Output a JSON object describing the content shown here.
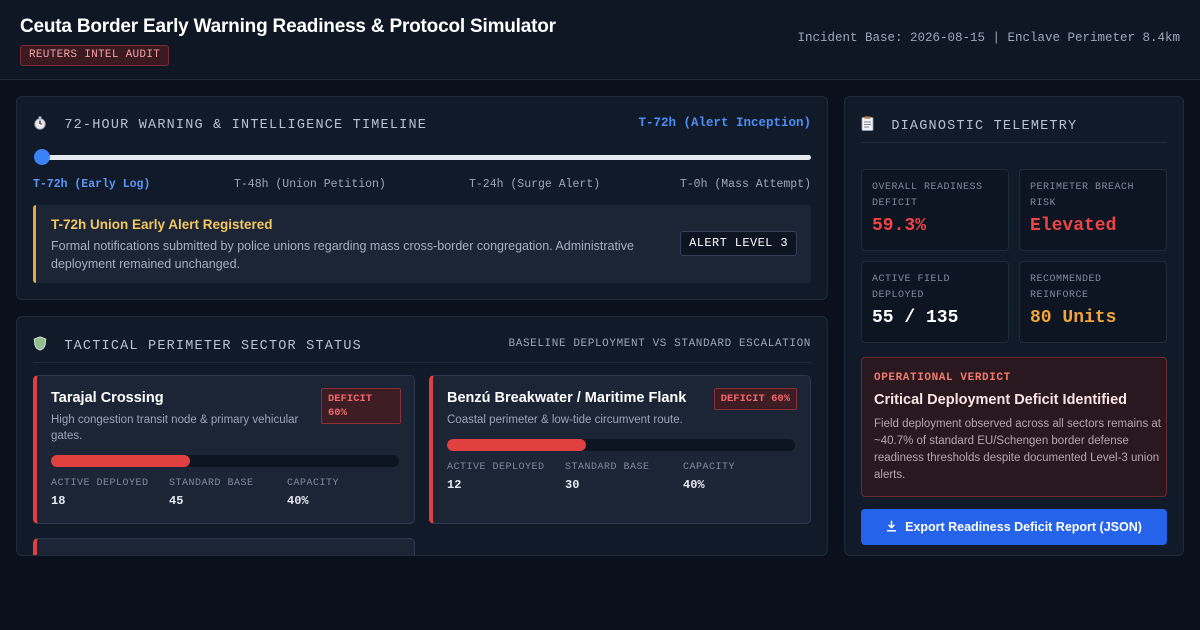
{
  "header": {
    "title": "Ceuta Border Early Warning Readiness & Protocol Simulator",
    "badge": "REUTERS INTEL AUDIT",
    "meta": "Incident Base: 2026-08-15 | Enclave Perimeter 8.4km"
  },
  "timeline": {
    "icon": "stopwatch-icon",
    "title": "72-HOUR WARNING & INTELLIGENCE TIMELINE",
    "current_label": "T-72h (Alert Inception)",
    "slider_position": 0,
    "labels": [
      "T-72h (Early Log)",
      "T-48h (Union Petition)",
      "T-24h (Surge Alert)",
      "T-0h (Mass Attempt)"
    ],
    "alert": {
      "title": "T-72h Union Early Alert Registered",
      "description": "Formal notifications submitted by police unions regarding mass cross-border congregation. Administrative deployment remained unchanged.",
      "level": "ALERT LEVEL 3",
      "accent_color": "#e7a93a"
    }
  },
  "sectors": {
    "icon": "shield-icon",
    "title": "TACTICAL PERIMETER SECTOR STATUS",
    "subtitle": "BASELINE DEPLOYMENT VS STANDARD ESCALATION",
    "stat_labels": {
      "deployed": "ACTIVE DEPLOYED",
      "standard": "STANDARD BASE",
      "capacity": "CAPACITY"
    },
    "cards": [
      {
        "name": "Tarajal Crossing",
        "description": "High congestion transit node & primary vehicular gates.",
        "deficit_line1": "DEFICIT",
        "deficit_line2": "60%",
        "deployed": "18",
        "standard": "45",
        "capacity": "40%",
        "fill": 0.4
      },
      {
        "name": "Benzú Breakwater / Maritime Flank",
        "description": "Coastal perimeter & low-tide circumvent route.",
        "deficit": "DEFICIT 60%",
        "deployed": "12",
        "standard": "30",
        "capacity": "40%",
        "fill": 0.4
      }
    ]
  },
  "telemetry": {
    "icon": "clipboard-icon",
    "title": "DIAGNOSTIC TELEMETRY",
    "metrics": {
      "readiness": {
        "label": "OVERALL READINESS DEFICIT",
        "value": "59.3%",
        "color": "#ef4444"
      },
      "breach": {
        "label": "PERIMETER BREACH RISK",
        "value": "Elevated",
        "color": "#ef4444"
      },
      "field": {
        "label": "ACTIVE FIELD DEPLOYED",
        "value": "55 / 135",
        "color": "#ffffff"
      },
      "reinforce": {
        "label": "RECOMMENDED REINFORCE",
        "value": "80 Units",
        "color": "#f0a43a"
      }
    },
    "verdict": {
      "label": "OPERATIONAL VERDICT",
      "title": "Critical Deployment Deficit Identified",
      "description": "Field deployment observed across all sectors remains at ~40.7% of standard EU/Schengen border defense readiness thresholds despite documented Level-3 union alerts."
    },
    "export_label": "Export Readiness Deficit Report (JSON)",
    "export_icon": "download-icon"
  }
}
